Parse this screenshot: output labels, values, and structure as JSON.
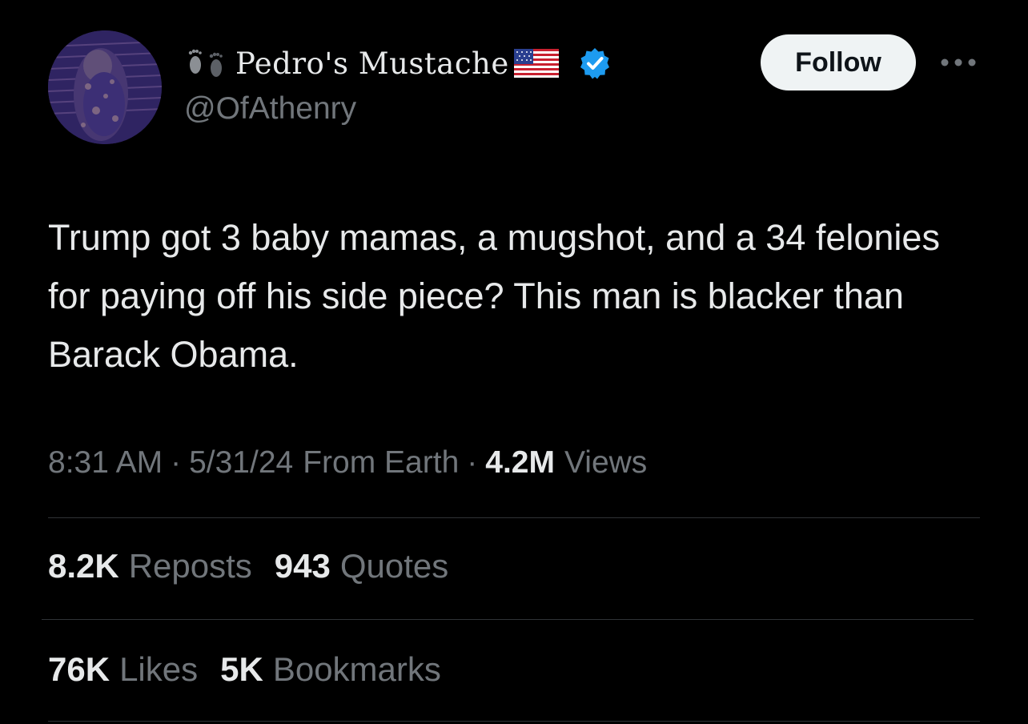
{
  "author": {
    "display_name": "Pedro's Mustache",
    "handle": "@OfAthenry",
    "avatar_icon": "avatar-image",
    "feet_icon": "footprints-emoji",
    "flag_icon": "us-flag-emoji",
    "verified_icon": "verified-badge",
    "verified_color": "#1d9bf0"
  },
  "actions": {
    "follow_label": "Follow",
    "more_icon": "more-dots-icon"
  },
  "tweet": {
    "text": "Trump got 3 baby mamas, a mugshot, and a 34 felonies for paying off his side piece? This man is blacker than Barack Obama."
  },
  "meta": {
    "time": "8:31 AM",
    "separator": "·",
    "date": "5/31/24",
    "source": "From Earth",
    "views_count": "4.2M",
    "views_label": "Views"
  },
  "stats": {
    "reposts_count": "8.2K",
    "reposts_label": "Reposts",
    "quotes_count": "943",
    "quotes_label": "Quotes",
    "likes_count": "76K",
    "likes_label": "Likes",
    "bookmarks_count": "5K",
    "bookmarks_label": "Bookmarks"
  },
  "colors": {
    "background": "#000000",
    "primary_text": "#e7e9ea",
    "secondary_text": "#71767b",
    "divider": "#2f3336",
    "follow_button_bg": "#eff3f4"
  }
}
